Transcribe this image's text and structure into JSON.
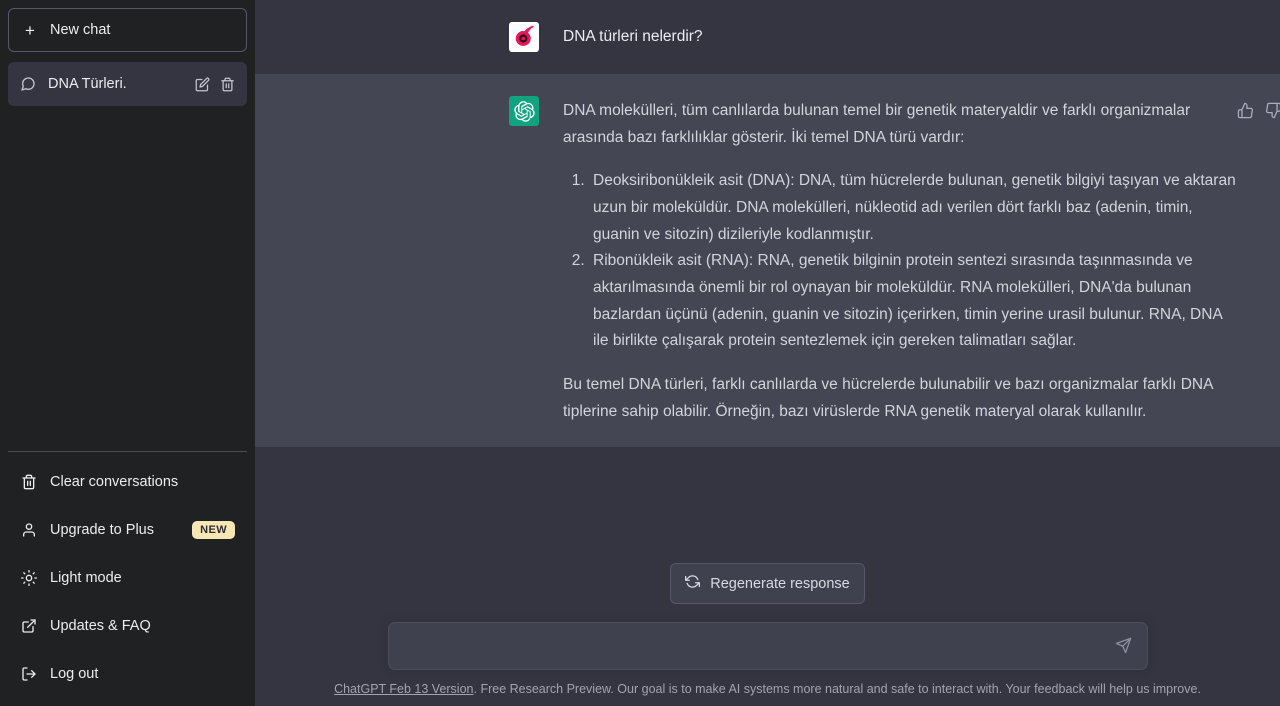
{
  "sidebar": {
    "new_chat_label": "New chat",
    "conversations": [
      {
        "title": "DNA Türleri.",
        "active": true
      }
    ],
    "bottom_items": [
      {
        "label": "Clear conversations",
        "icon": "trash-icon",
        "badge": ""
      },
      {
        "label": "Upgrade to Plus",
        "icon": "user-icon",
        "badge": "NEW"
      },
      {
        "label": "Light mode",
        "icon": "sun-icon",
        "badge": ""
      },
      {
        "label": "Updates & FAQ",
        "icon": "external-link-icon",
        "badge": ""
      },
      {
        "label": "Log out",
        "icon": "logout-icon",
        "badge": ""
      }
    ]
  },
  "conversation": {
    "user_message": "DNA türleri nelerdir?",
    "assistant": {
      "intro": "DNA molekülleri, tüm canlılarda bulunan temel bir genetik materyaldir ve farklı organizmalar arasında bazı farklılıklar gösterir. İki temel DNA türü vardır:",
      "list": [
        "Deoksiribonükleik asit (DNA): DNA, tüm hücrelerde bulunan, genetik bilgiyi taşıyan ve aktaran uzun bir moleküldür. DNA molekülleri, nükleotid adı verilen dört farklı baz (adenin, timin, guanin ve sitozin) dizileriyle kodlanmıştır.",
        "Ribonükleik asit (RNA): RNA, genetik bilginin protein sentezi sırasında taşınmasında ve aktarılmasında önemli bir rol oynayan bir moleküldür. RNA molekülleri, DNA'da bulunan bazlardan üçünü (adenin, guanin ve sitozin) içerirken, timin yerine urasil bulunur. RNA, DNA ile birlikte çalışarak protein sentezlemek için gereken talimatları sağlar."
      ],
      "outro": "Bu temel DNA türleri, farklı canlılarda ve hücrelerde bulunabilir ve bazı organizmalar farklı DNA tiplerine sahip olabilir. Örneğin, bazı virüslerde RNA genetik materyal olarak kullanılır."
    }
  },
  "composer": {
    "regenerate_label": "Regenerate response",
    "input_value": "",
    "input_placeholder": ""
  },
  "footer": {
    "version_link": "ChatGPT Feb 13 Version",
    "text": ". Free Research Preview. Our goal is to make AI systems more natural and safe to interact with. Your feedback will help us improve."
  },
  "colors": {
    "sidebar_bg": "#202123",
    "user_bg": "#343541",
    "assistant_bg": "#444654",
    "accent_green": "#10a37f",
    "badge_yellow": "#f6e7b5",
    "avatar_pink": "#e8175d"
  }
}
